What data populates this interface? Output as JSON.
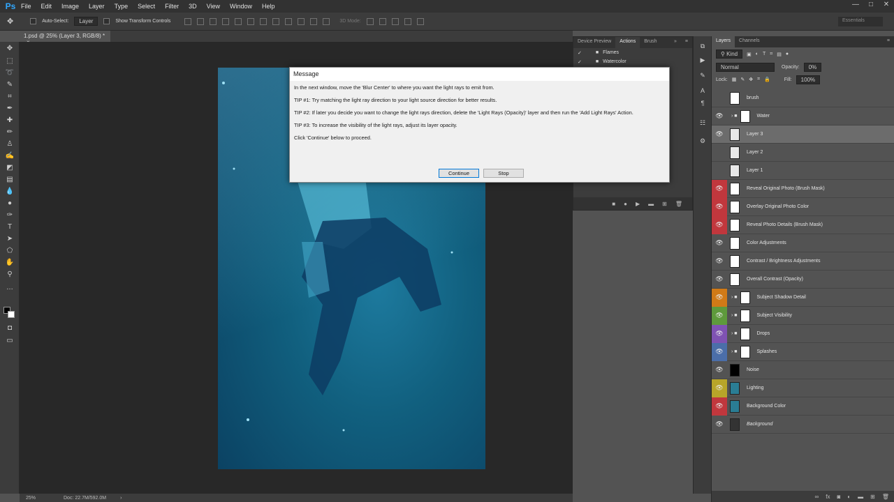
{
  "app": {
    "logo": "Ps"
  },
  "menu": [
    "File",
    "Edit",
    "Image",
    "Layer",
    "Type",
    "Select",
    "Filter",
    "3D",
    "View",
    "Window",
    "Help"
  ],
  "options": {
    "auto_select_label": "Auto-Select:",
    "auto_select_value": "Layer",
    "show_transform_label": "Show Transform Controls",
    "mode_label": "3D Mode:"
  },
  "workspace": "Essentials",
  "document": {
    "tab_title": "1.psd @ 25% (Layer 3, RGB/8) *",
    "close": "×"
  },
  "status": {
    "zoom": "25%",
    "doc": "Doc: 22.7M/592.0M"
  },
  "dialog": {
    "title": "Message",
    "lines": [
      "In the next window, move the 'Blur Center' to where you want the light rays to emit from.",
      "TIP #1: Try matching the light ray direction to your light source direction for better results.",
      "TIP #2: If later you decide you want to change the light rays direction, delete the 'Light Rays (Opacity)' layer and then run the 'Add Light Rays' Action.",
      "TIP #3: To increase the visibility of the light rays, adjust its layer opacity.",
      "Click 'Continue' below to proceed."
    ],
    "continue_label": "Continue",
    "stop_label": "Stop"
  },
  "midpanel": {
    "tabs": [
      "Device Preview",
      "Actions",
      "Brush"
    ],
    "actions": [
      "Flames",
      "Watercolor"
    ]
  },
  "layers_panel": {
    "tabs": [
      "Layers",
      "Channels"
    ],
    "kind": "Kind",
    "blend_mode": "Normal",
    "opacity_label": "Opacity:",
    "opacity_value": "0%",
    "lock_label": "Lock:",
    "fill_label": "Fill:",
    "fill_value": "100%",
    "layers": [
      {
        "name": "brush",
        "color": "",
        "visible": false
      },
      {
        "name": "Water",
        "color": "",
        "visible": true,
        "group": true
      },
      {
        "name": "Layer 3",
        "color": "",
        "visible": true,
        "selected": true
      },
      {
        "name": "Layer 2",
        "color": "",
        "visible": false
      },
      {
        "name": "Layer 1",
        "color": "",
        "visible": false
      },
      {
        "name": "Reveal Original Photo (Brush Mask)",
        "color": "#c1373d",
        "visible": true
      },
      {
        "name": "Overlay Original Photo Color",
        "color": "#c1373d",
        "visible": true
      },
      {
        "name": "Reveal Photo Details (Brush Mask)",
        "color": "#c1373d",
        "visible": true
      },
      {
        "name": "Color Adjustments",
        "color": "",
        "visible": true
      },
      {
        "name": "Contrast / Brightness Adjustments",
        "color": "",
        "visible": true
      },
      {
        "name": "Overall Contrast (Opacity)",
        "color": "",
        "visible": true
      },
      {
        "name": "Subject Shadow Detail",
        "color": "#d07a17",
        "visible": true,
        "group": true
      },
      {
        "name": "Subject Visibility",
        "color": "#5e9a3c",
        "visible": true,
        "group": true
      },
      {
        "name": "Drops",
        "color": "#7f52b3",
        "visible": true,
        "group": true
      },
      {
        "name": "Splashes",
        "color": "#4b6ea9",
        "visible": true,
        "group": true
      },
      {
        "name": "Noise",
        "color": "",
        "visible": true
      },
      {
        "name": "Lighting",
        "color": "#b8a529",
        "visible": true
      },
      {
        "name": "Background Color",
        "color": "#c1373d",
        "visible": true
      },
      {
        "name": "Background",
        "color": "",
        "visible": true
      }
    ]
  }
}
